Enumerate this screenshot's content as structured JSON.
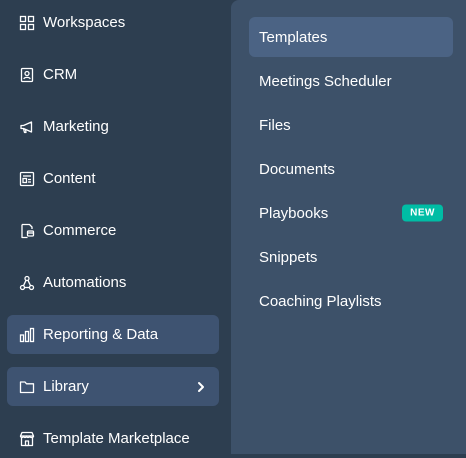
{
  "sidebar": {
    "items": [
      {
        "label": "Workspaces",
        "icon": "grid-icon"
      },
      {
        "label": "CRM",
        "icon": "contact-card-icon"
      },
      {
        "label": "Marketing",
        "icon": "megaphone-icon"
      },
      {
        "label": "Content",
        "icon": "content-icon"
      },
      {
        "label": "Commerce",
        "icon": "commerce-icon"
      },
      {
        "label": "Automations",
        "icon": "automation-icon"
      },
      {
        "label": "Reporting & Data",
        "icon": "bar-chart-icon"
      },
      {
        "label": "Library",
        "icon": "folder-icon"
      },
      {
        "label": "Template Marketplace",
        "icon": "storefront-icon"
      }
    ]
  },
  "submenu": {
    "items": [
      {
        "label": "Templates"
      },
      {
        "label": "Meetings Scheduler"
      },
      {
        "label": "Files"
      },
      {
        "label": "Documents"
      },
      {
        "label": "Playbooks",
        "badge": "NEW"
      },
      {
        "label": "Snippets"
      },
      {
        "label": "Coaching Playlists"
      }
    ]
  },
  "colors": {
    "sidebar_bg": "#2d3e50",
    "submenu_bg": "#3d5169",
    "active_bg": "#3e5371",
    "badge_bg": "#00bda5"
  }
}
